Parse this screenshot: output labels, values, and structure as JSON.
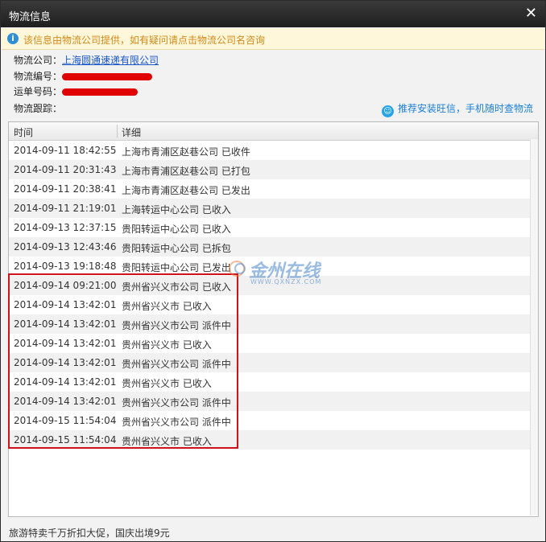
{
  "window": {
    "title": "物流信息"
  },
  "notice": {
    "text": "该信息由物流公司提供，如有疑问请点击物流公司名咨询"
  },
  "fields": {
    "company_label": "物流公司：",
    "company_value": "上海圆通速递有限公司",
    "number_label": "物流编号：",
    "waybill_label": "运单号码：",
    "tracking_label": "物流跟踪："
  },
  "recommend": {
    "text": "推荐安装旺信，手机随时查物流"
  },
  "table": {
    "headers": [
      "时间",
      "详细"
    ],
    "rows": [
      {
        "time": "2014-09-11 18:42:55",
        "detail": "上海市青浦区赵巷公司 已收件"
      },
      {
        "time": "2014-09-11 20:31:43",
        "detail": "上海市青浦区赵巷公司 已打包"
      },
      {
        "time": "2014-09-11 20:38:41",
        "detail": "上海市青浦区赵巷公司 已发出"
      },
      {
        "time": "2014-09-11 21:19:01",
        "detail": "上海转运中心公司 已收入"
      },
      {
        "time": "2014-09-13 12:37:15",
        "detail": "贵阳转运中心公司 已收入"
      },
      {
        "time": "2014-09-13 12:43:46",
        "detail": "贵阳转运中心公司 已拆包"
      },
      {
        "time": "2014-09-13 19:18:48",
        "detail": "贵阳转运中心公司 已发出"
      },
      {
        "time": "2014-09-14 09:21:00",
        "detail": "贵州省兴义市公司 已收入"
      },
      {
        "time": "2014-09-14 13:42:01",
        "detail": "贵州省兴义市 已收入"
      },
      {
        "time": "2014-09-14 13:42:01",
        "detail": "贵州省兴义市公司 派件中"
      },
      {
        "time": "2014-09-14 13:42:01",
        "detail": "贵州省兴义市 已收入"
      },
      {
        "time": "2014-09-14 13:42:01",
        "detail": "贵州省兴义市公司 派件中"
      },
      {
        "time": "2014-09-14 13:42:01",
        "detail": "贵州省兴义市 已收入"
      },
      {
        "time": "2014-09-14 13:42:01",
        "detail": "贵州省兴义市公司 派件中"
      },
      {
        "time": "2014-09-15 11:54:04",
        "detail": "贵州省兴义市公司 派件中"
      },
      {
        "time": "2014-09-15 11:54:04",
        "detail": "贵州省兴义市 已收入"
      }
    ]
  },
  "watermark": {
    "title": "金州在线",
    "url": "WWW.QXNZX.COM"
  },
  "footer": {
    "text": "旅游特卖千万折扣大促，国庆出境9元"
  },
  "colors": {
    "highlight": "#d0121b",
    "link": "#1a57c5",
    "notice_text": "#d28a1a",
    "redaction": "#e00000"
  }
}
